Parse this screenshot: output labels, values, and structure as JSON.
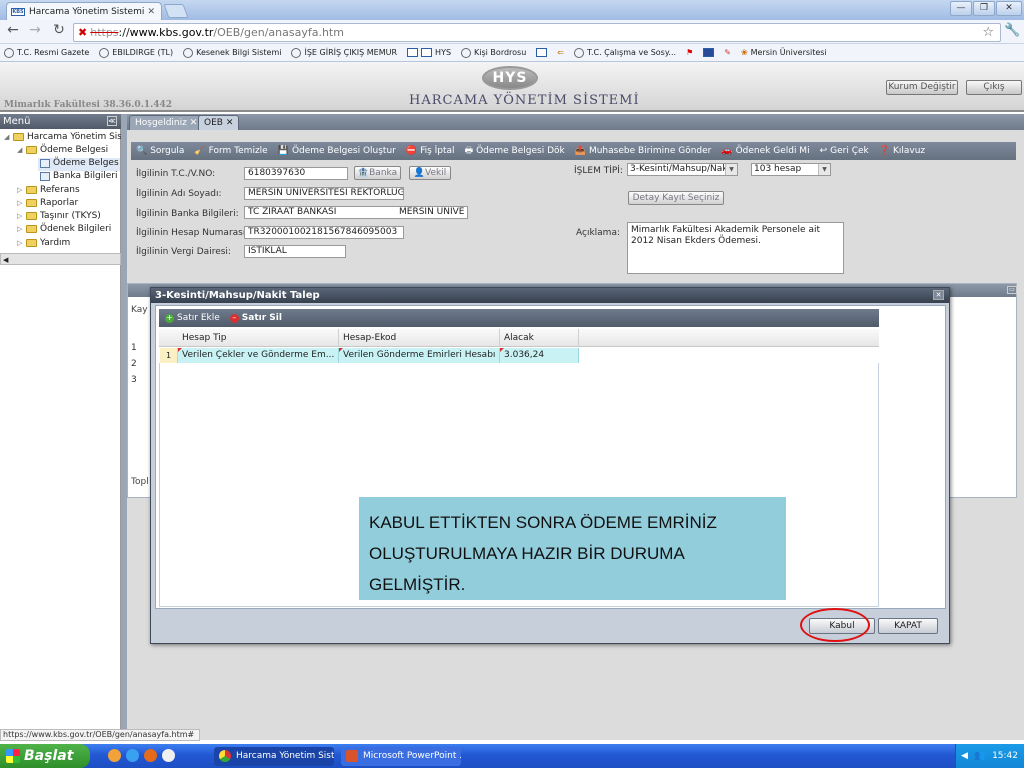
{
  "browser": {
    "tab_title": "Harcama Yönetim Sistemi",
    "url_scheme": "https",
    "url_sep": "://",
    "url_host": "www.kbs.gov.tr",
    "url_path": "/OEB/gen/anasayfa.htm",
    "bookmarks": [
      "T.C. Resmi Gazete",
      "EBILDIRGE (TL)",
      "Kesenek Bilgi Sistemi",
      "İŞE GİRİŞ ÇIKIŞ MEMUR",
      "HYS",
      "Kişi Bordrosu",
      "T.C. Çalışma ve Sosy...",
      "Mersin Üniversitesi"
    ],
    "status_url": "https://www.kbs.gov.tr/OEB/gen/anasayfa.htm#"
  },
  "app": {
    "logo_text": "HYS",
    "title": "HARCAMA YÖNETİM SİSTEMİ",
    "unit_info": "Mimarlık Fakültesi 38.36.0.1.442",
    "btn_change_unit": "Kurum Değiştir",
    "btn_exit": "Çıkış"
  },
  "menu": {
    "title": "Menü",
    "items": [
      "Harcama Yönetim Sis",
      "Ödeme Belgesi",
      "Ödeme Belges",
      "Banka Bilgileri",
      "Referans",
      "Raporlar",
      "Taşınır (TKYS)",
      "Ödenek Bilgileri",
      "Yardım"
    ]
  },
  "tabs": [
    "Hoşgeldiniz",
    "OEB"
  ],
  "toolbar": [
    "Sorgula",
    "Form Temizle",
    "Ödeme Belgesi Oluştur",
    "Fiş İptal",
    "Ödeme Belgesi Dök",
    "Muhasebe Birimine Gönder",
    "Ödenek Geldi Mi",
    "Geri Çek",
    "Kılavuz"
  ],
  "form": {
    "tc_label": "İlgilinin T.C./V.NO:",
    "tc_value": "6180397630",
    "btn_banka": "Banka",
    "btn_vekil": "Vekil",
    "name_label": "İlgilinin Adı Soyadı:",
    "name_value": "MERSİN ÜNİVERSİTESİ REKTÖRLÜĞ",
    "bank_label": "İlgilinin Banka Bilgileri:",
    "bank_value": "TC ZIRAAT BANKASI",
    "bank_branch": "MERSİN ÜNİVE",
    "iban_label": "İlgilinin Hesap Numarası:",
    "iban_value": "TR320001002181567846095003",
    "tax_label": "İlgilinin Vergi Dairesi:",
    "tax_value": "İSTİKLAL",
    "islem_label": "İŞLEM TİPİ:",
    "islem_value": "3-Kesinti/Mahsup/Nak",
    "hesap_value": "103 hesap",
    "btn_detail": "Detay Kayıt Seçiniz",
    "desc_label": "Açıklama:",
    "desc_value": "Mimarlık Fakültesi Akademik Personele ait 2012 Nisan Ekders Ödemesi."
  },
  "background_grid": {
    "partial_label": "Kay",
    "rows": [
      "1",
      "2",
      "3"
    ],
    "total_label": "Topl"
  },
  "modal": {
    "title": "3-Kesinti/Mahsup/Nakit Talep",
    "add_row": "Satır Ekle",
    "delete_row": "Satır Sil",
    "columns": [
      "Hesap Tip",
      "Hesap-Ekod",
      "Alacak"
    ],
    "rows": [
      {
        "num": "1",
        "hesap_tip": "Verilen Çekler ve Gönderme Em...",
        "hesap_ekod": "Verilen Gönderme Emirleri Hesabı",
        "alacak": "3.036,24"
      }
    ],
    "callout": "KABUL ETTİKTEN SONRA ÖDEME EMRİNİZ OLUŞTURULMAYA HAZIR BİR DURUMA GELMİŞTİR.",
    "btn_accept": "Kabul",
    "btn_close": "KAPAT"
  },
  "taskbar": {
    "start": "Başlat",
    "tasks": [
      "Harcama Yönetim Sist...",
      "Microsoft PowerPoint ..."
    ],
    "clock": "15:42"
  },
  "colors": {
    "accent_ring": "#e01010",
    "callout_bg": "#92cddc",
    "selected_row": "#c8f2f4"
  }
}
